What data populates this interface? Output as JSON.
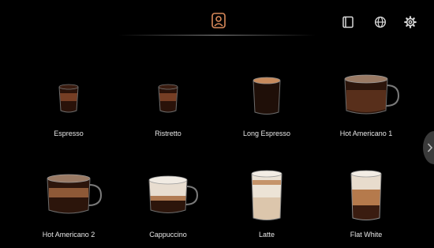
{
  "header": {
    "active_icon": "user-profile-icon",
    "right_icons": [
      "book-icon",
      "globe-icon",
      "gear-icon"
    ]
  },
  "drinks": [
    {
      "label": "Espresso",
      "cup": "small-glass",
      "fill": "espresso"
    },
    {
      "label": "Ristretto",
      "cup": "small-glass",
      "fill": "espresso"
    },
    {
      "label": "Long Espresso",
      "cup": "tall-glass",
      "fill": "espresso"
    },
    {
      "label": "Hot Americano 1",
      "cup": "mug",
      "fill": "americano"
    },
    {
      "label": "Hot Americano 2",
      "cup": "mug",
      "fill": "americano"
    },
    {
      "label": "Cappuccino",
      "cup": "mug",
      "fill": "milk"
    },
    {
      "label": "Latte",
      "cup": "tall-glass",
      "fill": "latte"
    },
    {
      "label": "Flat White",
      "cup": "tall-glass",
      "fill": "flatwhite"
    }
  ],
  "colors": {
    "background": "#000000",
    "accent": "#d9895a",
    "icon": "#d8d8d8",
    "coffee": "#3a1c10",
    "crema": "#b3774f",
    "milk": "#e9e1d5"
  }
}
